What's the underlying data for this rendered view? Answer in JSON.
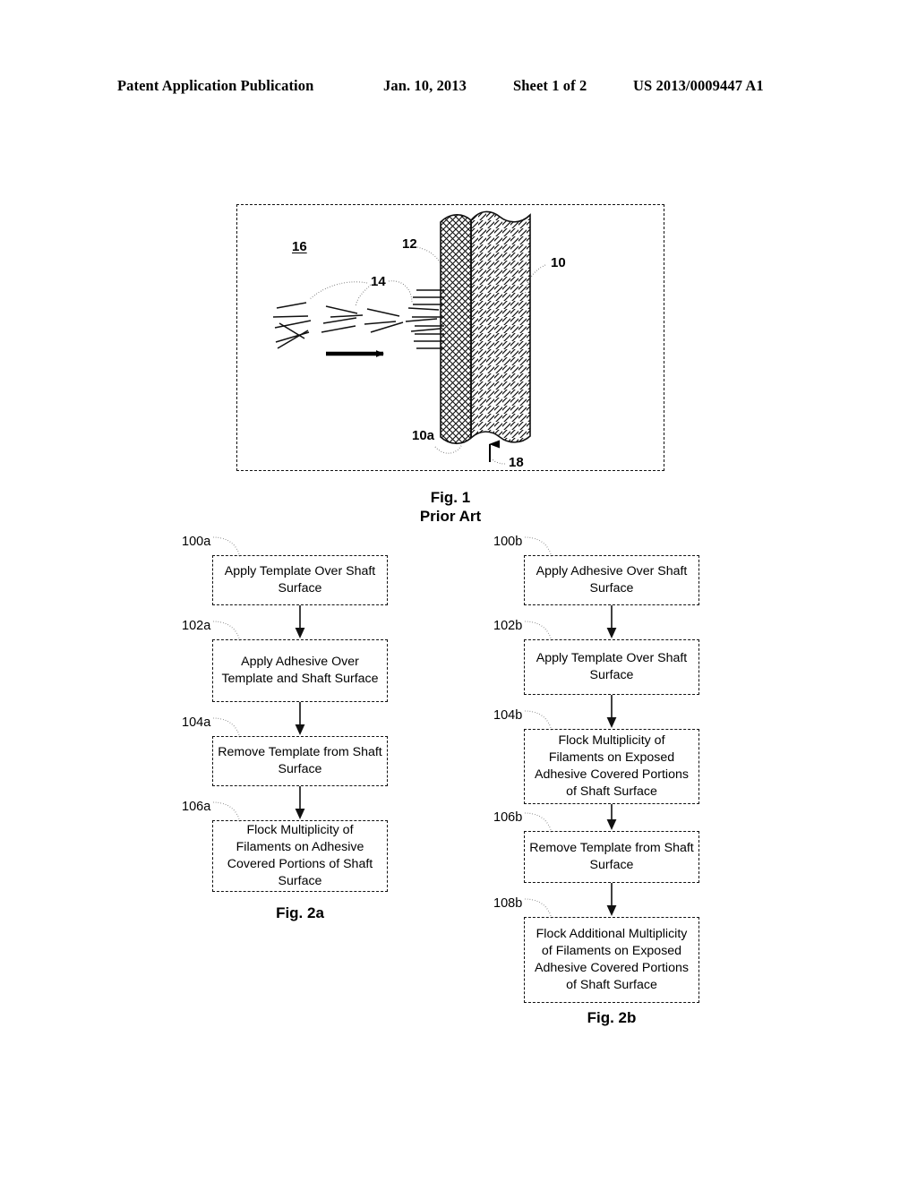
{
  "header": {
    "publication": "Patent Application Publication",
    "date": "Jan. 10, 2013",
    "sheet": "Sheet 1 of 2",
    "patent_number": "US 2013/0009447 A1"
  },
  "figure1": {
    "caption_line1": "Fig. 1",
    "caption_line2": "Prior Art",
    "reference_numerals": {
      "flock_chamber": "16",
      "filaments": "14",
      "adhesive_layer": "12",
      "shaft": "10",
      "shaft_surface": "10a",
      "flocking_direction": "18"
    }
  },
  "figure2a": {
    "caption": "Fig. 2a",
    "steps": [
      {
        "id": "100a",
        "text": "Apply Template Over Shaft Surface"
      },
      {
        "id": "102a",
        "text": "Apply Adhesive Over Template and Shaft Surface"
      },
      {
        "id": "104a",
        "text": "Remove Template from Shaft Surface"
      },
      {
        "id": "106a",
        "text": "Flock Multiplicity of Filaments on Adhesive Covered Portions of Shaft Surface"
      }
    ]
  },
  "figure2b": {
    "caption": "Fig. 2b",
    "steps": [
      {
        "id": "100b",
        "text": "Apply Adhesive Over Shaft Surface"
      },
      {
        "id": "102b",
        "text": "Apply Template Over Shaft Surface"
      },
      {
        "id": "104b",
        "text": "Flock Multiplicity of Filaments on Exposed Adhesive Covered Portions of Shaft Surface"
      },
      {
        "id": "106b",
        "text": "Remove Template from Shaft Surface"
      },
      {
        "id": "108b",
        "text": "Flock Additional Multiplicity of Filaments on Exposed Adhesive Covered Portions of Shaft Surface"
      }
    ]
  }
}
